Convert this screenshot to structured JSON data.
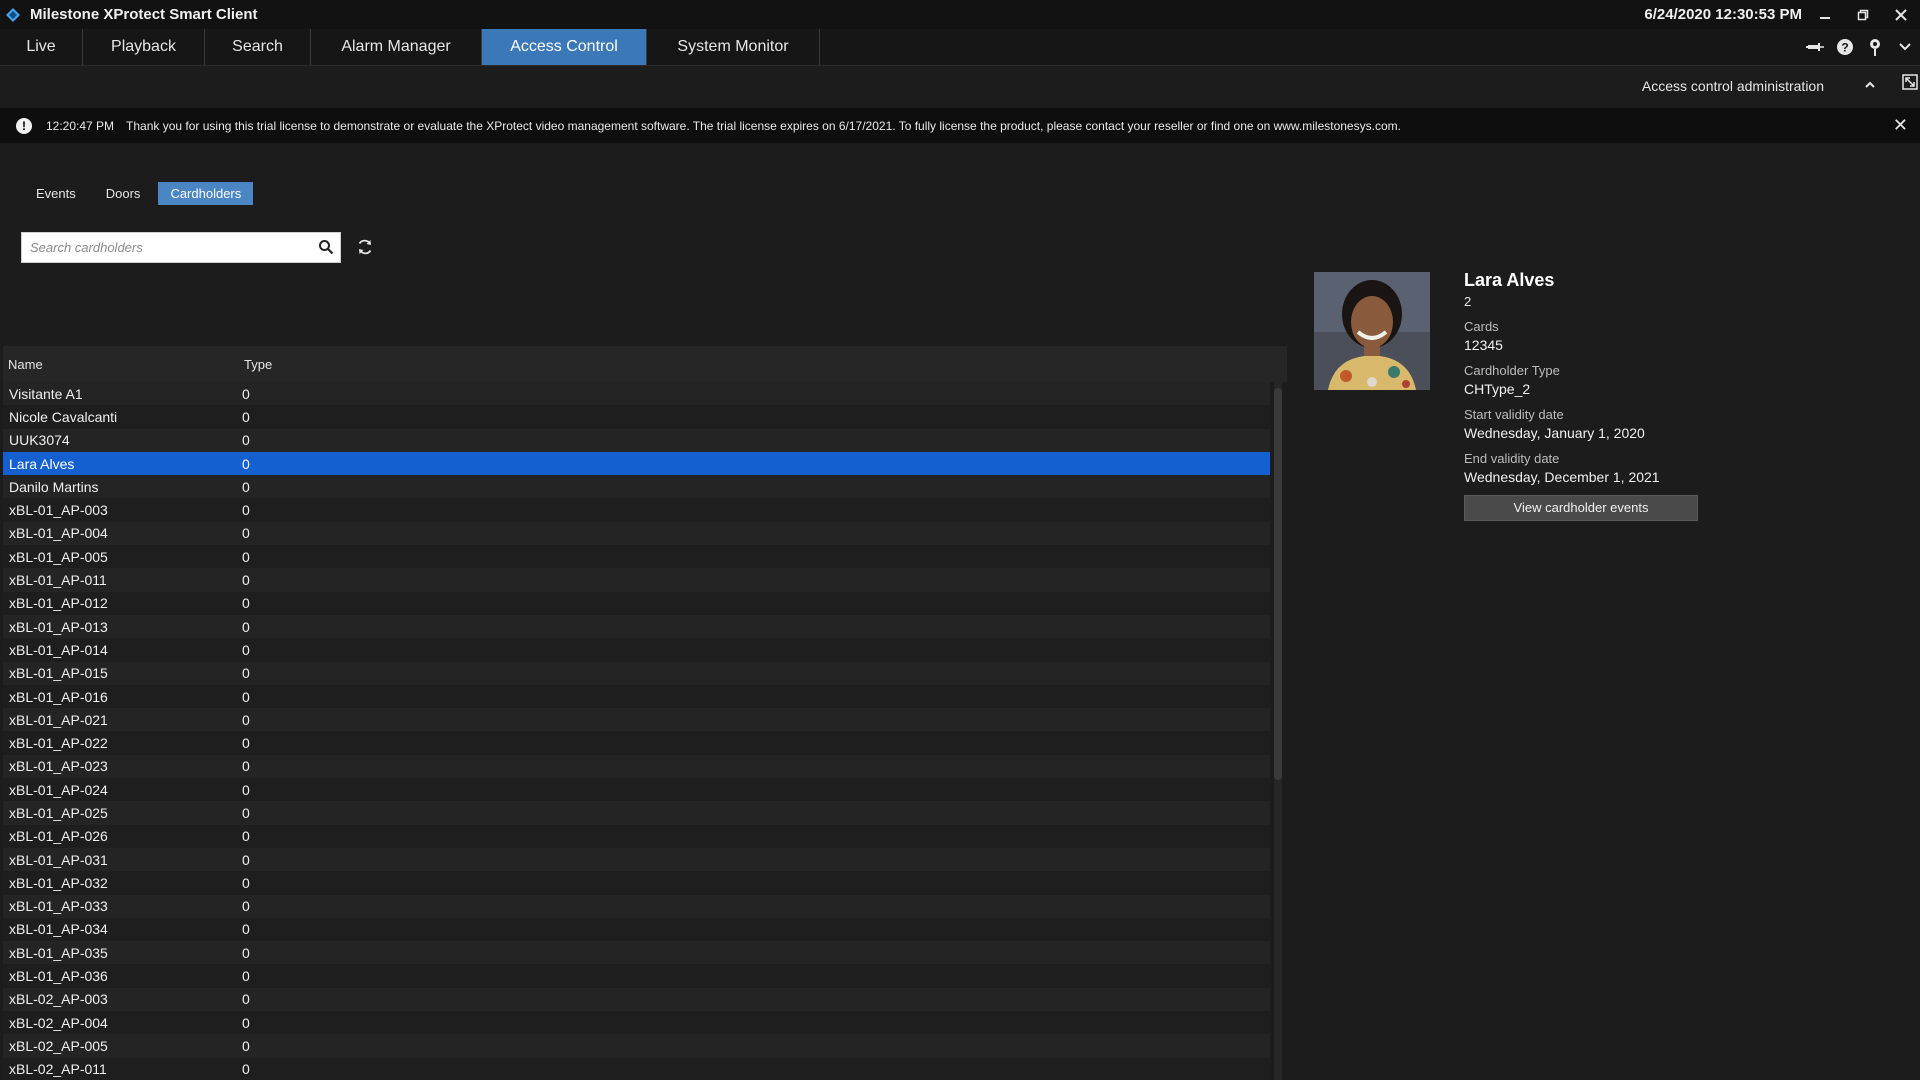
{
  "window": {
    "title": "Milestone XProtect Smart Client",
    "clock": "6/24/2020 12:30:53 PM",
    "controls": [
      "minimize-icon",
      "restore-icon",
      "close-icon"
    ]
  },
  "nav": {
    "tabs": [
      {
        "label": "Live"
      },
      {
        "label": "Playback"
      },
      {
        "label": "Search"
      },
      {
        "label": "Alarm Manager"
      },
      {
        "label": "Access Control",
        "active": true
      },
      {
        "label": "System Monitor"
      }
    ],
    "icons": [
      "pin-icon",
      "help-icon",
      "location-icon",
      "chevron-down-icon"
    ]
  },
  "subbar": {
    "admin_label": "Access control administration"
  },
  "notice": {
    "time": "12:20:47 PM",
    "message": "Thank you for using this trial license to demonstrate or evaluate the XProtect video management software. The trial license expires on 6/17/2021. To fully license the product, please contact your reseller or find one on www.milestonesys.com."
  },
  "subtabs": [
    {
      "label": "Events"
    },
    {
      "label": "Doors"
    },
    {
      "label": "Cardholders",
      "active": true
    }
  ],
  "search": {
    "placeholder": "Search cardholders",
    "value": ""
  },
  "table": {
    "columns": [
      "Name",
      "Type"
    ],
    "rows": [
      {
        "name": "Visitante A1",
        "type": "0"
      },
      {
        "name": "Nicole Cavalcanti",
        "type": "0"
      },
      {
        "name": "UUK3074",
        "type": "0"
      },
      {
        "name": "Lara Alves",
        "type": "0",
        "selected": true
      },
      {
        "name": "Danilo Martins",
        "type": "0"
      },
      {
        "name": "xBL-01_AP-003",
        "type": "0"
      },
      {
        "name": "xBL-01_AP-004",
        "type": "0"
      },
      {
        "name": "xBL-01_AP-005",
        "type": "0"
      },
      {
        "name": "xBL-01_AP-011",
        "type": "0"
      },
      {
        "name": "xBL-01_AP-012",
        "type": "0"
      },
      {
        "name": "xBL-01_AP-013",
        "type": "0"
      },
      {
        "name": "xBL-01_AP-014",
        "type": "0"
      },
      {
        "name": "xBL-01_AP-015",
        "type": "0"
      },
      {
        "name": "xBL-01_AP-016",
        "type": "0"
      },
      {
        "name": "xBL-01_AP-021",
        "type": "0"
      },
      {
        "name": "xBL-01_AP-022",
        "type": "0"
      },
      {
        "name": "xBL-01_AP-023",
        "type": "0"
      },
      {
        "name": "xBL-01_AP-024",
        "type": "0"
      },
      {
        "name": "xBL-01_AP-025",
        "type": "0"
      },
      {
        "name": "xBL-01_AP-026",
        "type": "0"
      },
      {
        "name": "xBL-01_AP-031",
        "type": "0"
      },
      {
        "name": "xBL-01_AP-032",
        "type": "0"
      },
      {
        "name": "xBL-01_AP-033",
        "type": "0"
      },
      {
        "name": "xBL-01_AP-034",
        "type": "0"
      },
      {
        "name": "xBL-01_AP-035",
        "type": "0"
      },
      {
        "name": "xBL-01_AP-036",
        "type": "0"
      },
      {
        "name": "xBL-02_AP-003",
        "type": "0"
      },
      {
        "name": "xBL-02_AP-004",
        "type": "0"
      },
      {
        "name": "xBL-02_AP-005",
        "type": "0"
      },
      {
        "name": "xBL-02_AP-011",
        "type": "0"
      }
    ]
  },
  "detail": {
    "name": "Lara Alves",
    "id": "2",
    "cards_label": "Cards",
    "cards_value": "12345",
    "type_label": "Cardholder Type",
    "type_value": "CHType_2",
    "start_label": "Start validity date",
    "start_value": "Wednesday, January 1, 2020",
    "end_label": "End validity date",
    "end_value": "Wednesday, December 1, 2021",
    "button_label": "View cardholder events"
  },
  "colors": {
    "accent": "#3a78b8",
    "selected_row": "#1560d0",
    "background": "#1c1c1c"
  }
}
